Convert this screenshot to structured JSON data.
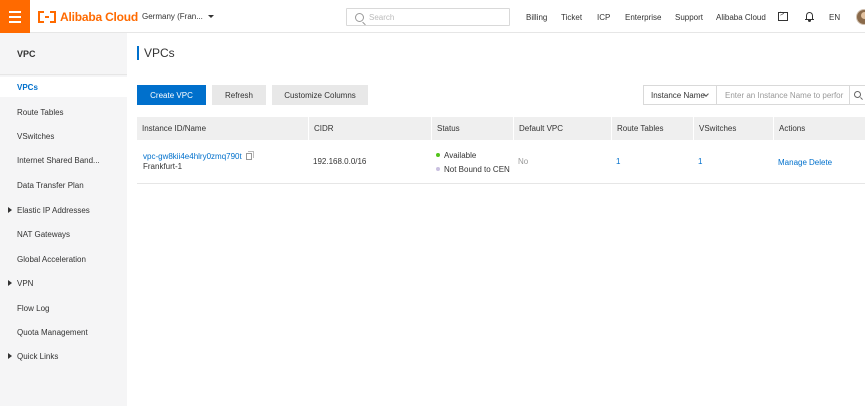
{
  "header": {
    "logo_text": "Alibaba Cloud",
    "region": "Germany (Fran...",
    "search_placeholder": "Search",
    "nav": [
      "Billing",
      "Ticket",
      "ICP",
      "Enterprise",
      "Support",
      "Alibaba Cloud"
    ],
    "language": "EN",
    "brand_color": "#ff6a00"
  },
  "sidebar": {
    "title": "VPC",
    "items": [
      {
        "label": "VPCs",
        "active": true,
        "expandable": false
      },
      {
        "label": "Route Tables",
        "active": false,
        "expandable": false
      },
      {
        "label": "VSwitches",
        "active": false,
        "expandable": false
      },
      {
        "label": "Internet Shared Band...",
        "active": false,
        "expandable": false
      },
      {
        "label": "Data Transfer Plan",
        "active": false,
        "expandable": false
      },
      {
        "label": "Elastic IP Addresses",
        "active": false,
        "expandable": true
      },
      {
        "label": "NAT Gateways",
        "active": false,
        "expandable": false
      },
      {
        "label": "Global Acceleration",
        "active": false,
        "expandable": false
      },
      {
        "label": "VPN",
        "active": false,
        "expandable": true
      },
      {
        "label": "Flow Log",
        "active": false,
        "expandable": false
      },
      {
        "label": "Quota Management",
        "active": false,
        "expandable": false
      },
      {
        "label": "Quick Links",
        "active": false,
        "expandable": true
      }
    ]
  },
  "main": {
    "title": "VPCs",
    "toolbar": {
      "create_label": "Create VPC",
      "refresh_label": "Refresh",
      "customize_label": "Customize Columns",
      "filter_select": "Instance Name",
      "filter_placeholder": "Enter an Instance Name to perfor"
    },
    "table": {
      "columns": [
        "Instance ID/Name",
        "CIDR",
        "Status",
        "Default VPC",
        "Route Tables",
        "VSwitches",
        "Actions"
      ],
      "rows": [
        {
          "instance_id": "vpc-gw8kii4e4hlry0zmq790t",
          "instance_name": "Frankfurt-1",
          "cidr": "192.168.0.0/16",
          "status": "Available",
          "cen_status": "Not Bound to CEN",
          "default_vpc": "No",
          "route_tables": "1",
          "vswitches": "1",
          "actions": [
            "Manage",
            "Delete"
          ]
        }
      ]
    }
  },
  "colors": {
    "accent": "#0070cc",
    "status_available": "#52c41a",
    "status_not_bound": "#c9c0e0"
  }
}
